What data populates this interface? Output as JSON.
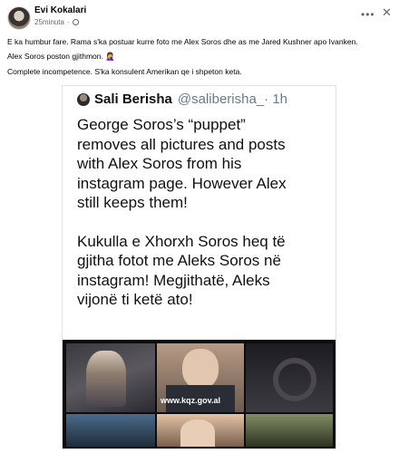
{
  "post": {
    "author": "Evi Kokalari",
    "time": "25minuta",
    "visibility_icon": "globe-icon",
    "more_icon": "•••",
    "close_icon": "✕",
    "lines": [
      "E ka humbur fare. Rama s'ka postuar kurre foto me Alex Soros dhe as me Jared Kushner apo Ivanken.",
      "Alex Soros poston gjithmon. 🤦‍♀️",
      "Complete incompetence. S'ka konsulent Amerikan qe i shpeton keta."
    ]
  },
  "tweet": {
    "name": "Sali Berisha",
    "handle": "@saliberisha_",
    "time": " · 1h",
    "paragraph1": [
      "George Soros’s “puppet”",
      "removes all pictures and posts",
      "with Alex Soros from his",
      "instagram page. However Alex",
      "still keeps them!"
    ],
    "paragraph2": [
      "Kukulla e Xhorxh Soros heq të",
      "gjitha fotot me Aleks Soros në",
      "instagram! Megjithatë, Aleks",
      "vijonë ti ketë ato!"
    ],
    "media_overlay_text": "www.kqz.gov.al"
  }
}
